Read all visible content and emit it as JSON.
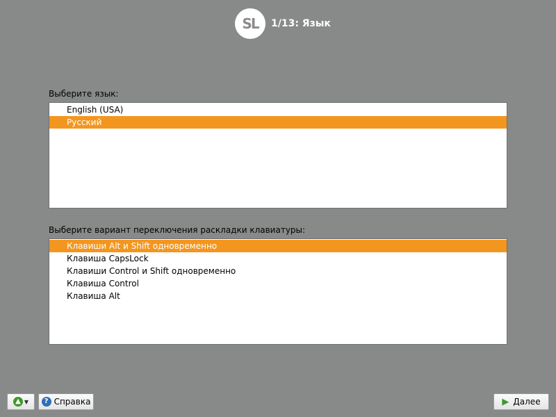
{
  "header": {
    "logo_text": "SL",
    "step_title": "1/13: Язык"
  },
  "language": {
    "label": "Выберите язык:",
    "items": [
      {
        "label": "English (USA)",
        "selected": false
      },
      {
        "label": "Русский",
        "selected": true
      }
    ]
  },
  "keyboard": {
    "label": "Выберите вариант переключения раскладки клавиатуры:",
    "items": [
      {
        "label": "Клавиши Alt и Shift одновременно",
        "selected": true
      },
      {
        "label": "Клавиша CapsLock",
        "selected": false
      },
      {
        "label": "Клавиши Control и Shift одновременно",
        "selected": false
      },
      {
        "label": "Клавиша Control",
        "selected": false
      },
      {
        "label": "Клавиша Alt",
        "selected": false
      }
    ]
  },
  "footer": {
    "help_label": "Справка",
    "next_label": "Далее"
  },
  "colors": {
    "background": "#888a8a",
    "selection": "#f3961f"
  },
  "icons": {
    "menu": "green-up-arrow-icon",
    "help": "help-question-icon",
    "next": "green-right-arrow-icon"
  }
}
